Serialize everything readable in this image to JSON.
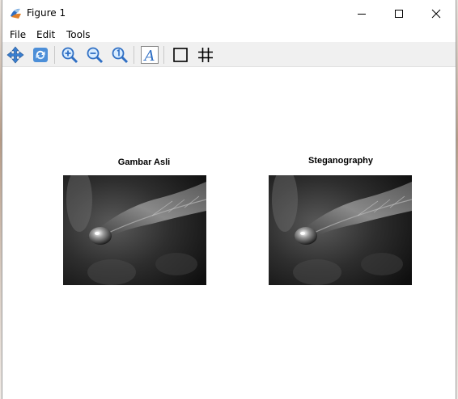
{
  "window": {
    "title": "Figure 1",
    "app_icon": "matlab-figure-icon",
    "controls": [
      "minimize-icon",
      "maximize-icon",
      "close-icon"
    ]
  },
  "menu": {
    "items": [
      {
        "label": "File"
      },
      {
        "label": "Edit"
      },
      {
        "label": "Tools"
      }
    ]
  },
  "toolbar": {
    "tools": [
      "pan-icon",
      "rotate-icon",
      "zoom-in-icon",
      "zoom-out-icon",
      "zoom-reset-icon",
      "insert-text-icon",
      "axes-box-icon",
      "grid-icon"
    ]
  },
  "figure": {
    "subplots": [
      {
        "title": "Gambar Asli",
        "image": "grayscale water droplet on leaf"
      },
      {
        "title": "Steganography",
        "image": "grayscale water droplet on leaf"
      }
    ]
  },
  "colors": {
    "window_bg": "#ffffff",
    "toolbar_bg": "#f0f0f0",
    "icon_blue": "#2f6fc4"
  }
}
